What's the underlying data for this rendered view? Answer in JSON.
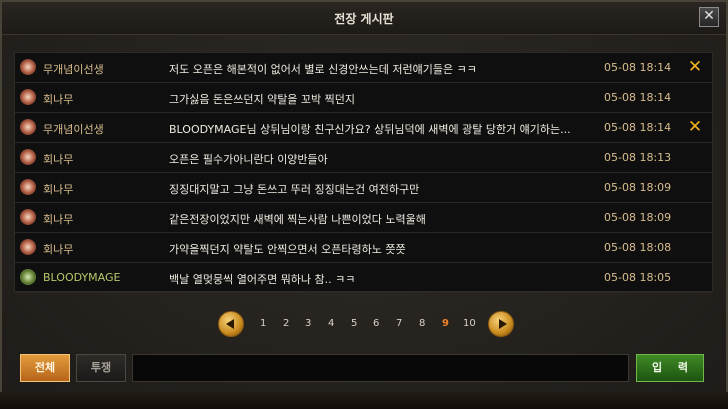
{
  "window": {
    "title": "전장 게시판",
    "close_label": "✕"
  },
  "messages": [
    {
      "name": "무개념이선생",
      "text": "저도 오픈은 해본적이 없어서 별로 신경안쓰는데 저런얘기들은 ㅋㅋ",
      "time": "05-08 18:14",
      "badge": "red",
      "deletable": true
    },
    {
      "name": "회나무",
      "text": "그가싫음 돈은쓰던지 약탈을 꼬박 찍던지",
      "time": "05-08 18:14",
      "badge": "red",
      "deletable": false
    },
    {
      "name": "무개념이선생",
      "text": "BLOODYMAGE님 상뒤님이랑 친구신가요? 상뒤님덕에 새벽에 광탈 당한거 얘기하는...",
      "time": "05-08 18:14",
      "badge": "red",
      "deletable": true
    },
    {
      "name": "회나무",
      "text": "오픈은 필수가아니란다 이양반들아",
      "time": "05-08 18:13",
      "badge": "red",
      "deletable": false
    },
    {
      "name": "회나무",
      "text": "징징대지말고 그냥 돈쓰고 뚜러 징징대는건 여전하구만",
      "time": "05-08 18:09",
      "badge": "red",
      "deletable": false
    },
    {
      "name": "회나무",
      "text": "같은전장이었지만 새벽에 찍는사람 나쁜이었다 노력울해",
      "time": "05-08 18:09",
      "badge": "red",
      "deletable": false
    },
    {
      "name": "회나무",
      "text": "가약을찍던지 약탈도 안찍으면서 오픈타령하노 쯧쯧",
      "time": "05-08 18:08",
      "badge": "red",
      "deletable": false
    },
    {
      "name": "BLOODYMAGE",
      "text": "백날 열멎뭉씩 열어주면 뭐하나 참.. ㅋㅋ",
      "time": "05-08 18:05",
      "badge": "green",
      "deletable": false
    }
  ],
  "pagination": {
    "pages": [
      "1",
      "2",
      "3",
      "4",
      "5",
      "6",
      "7",
      "8",
      "9",
      "10"
    ],
    "current": "9"
  },
  "input_bar": {
    "tab_all": "전체",
    "tab_whisper": "투쟁",
    "input_value": "",
    "input_placeholder": "",
    "submit_label": "입 력"
  },
  "colors": {
    "name": "#d8bd8e",
    "name_highlight": "#b8c96a",
    "delete_icon": "#f5b220",
    "current_page": "#f0822a"
  }
}
